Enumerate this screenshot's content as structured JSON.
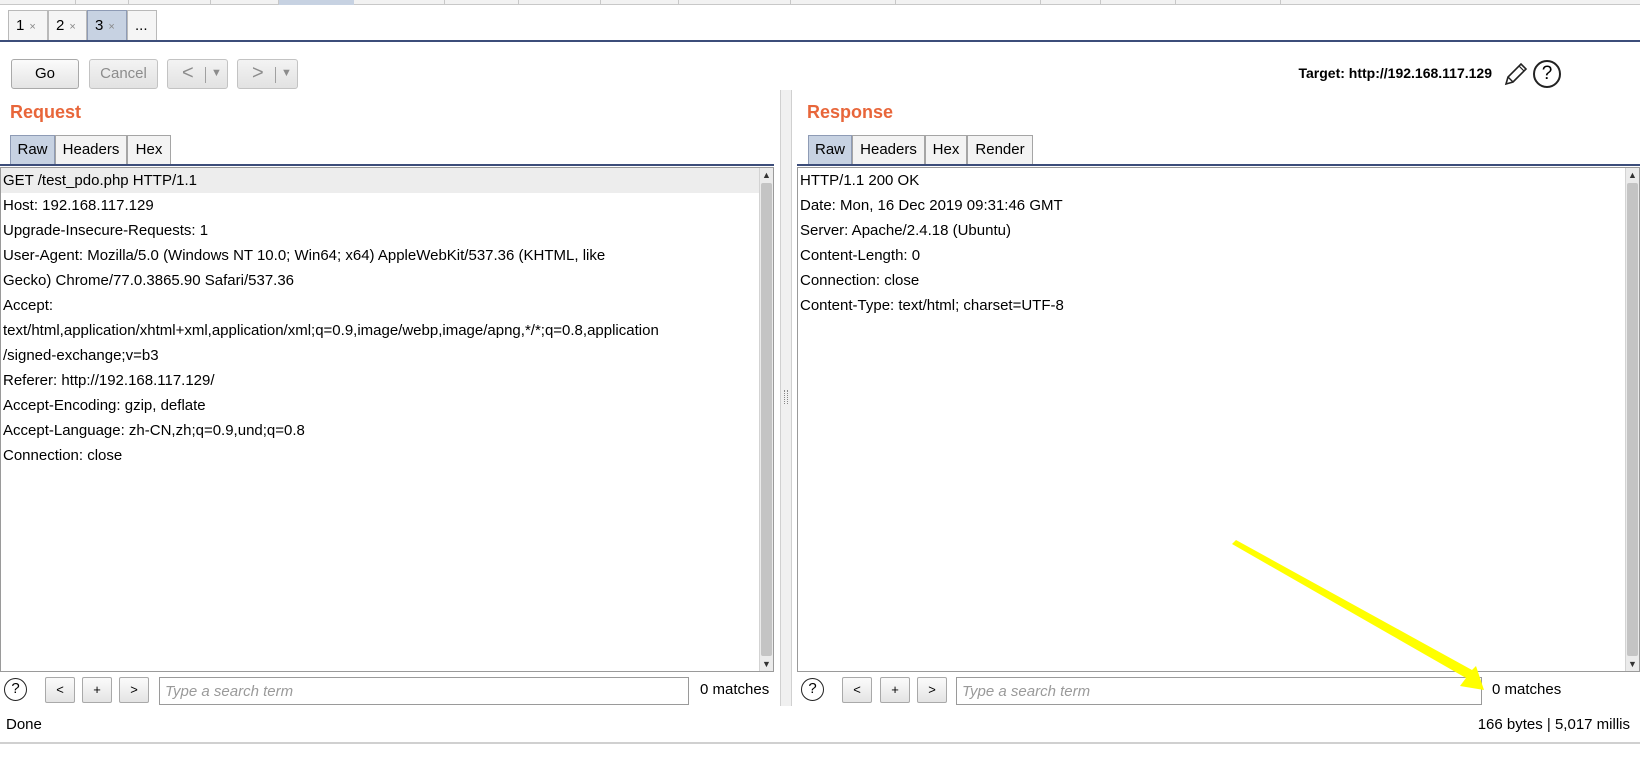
{
  "subtabs": [
    {
      "label": "1",
      "close": "×"
    },
    {
      "label": "2",
      "close": "×"
    },
    {
      "label": "3",
      "close": "×"
    },
    {
      "label": "...",
      "close": ""
    }
  ],
  "toolbar": {
    "go_label": "Go",
    "cancel_label": "Cancel",
    "back_arrow": "<",
    "forward_arrow": ">",
    "dropdown": "▼",
    "target_text": "Target: http://192.168.117.129",
    "help": "?"
  },
  "request": {
    "title": "Request",
    "tabs": [
      "Raw",
      "Headers",
      "Hex"
    ],
    "lines": [
      "GET /test_pdo.php HTTP/1.1",
      "Host: 192.168.117.129",
      "Upgrade-Insecure-Requests: 1",
      "User-Agent: Mozilla/5.0 (Windows NT 10.0; Win64; x64) AppleWebKit/537.36 (KHTML, like",
      "Gecko) Chrome/77.0.3865.90 Safari/537.36",
      "Accept:",
      "text/html,application/xhtml+xml,application/xml;q=0.9,image/webp,image/apng,*/*;q=0.8,application",
      "/signed-exchange;v=b3",
      "Referer: http://192.168.117.129/",
      "Accept-Encoding: gzip, deflate",
      "Accept-Language: zh-CN,zh;q=0.9,und;q=0.8",
      "Connection: close"
    ],
    "search": {
      "help": "?",
      "prev": "<",
      "add": "+",
      "next": ">",
      "placeholder": "Type a search term",
      "matches": "0 matches"
    }
  },
  "response": {
    "title": "Response",
    "tabs": [
      "Raw",
      "Headers",
      "Hex",
      "Render"
    ],
    "lines": [
      "HTTP/1.1 200 OK",
      "Date: Mon, 16 Dec 2019 09:31:46 GMT",
      "Server: Apache/2.4.18 (Ubuntu)",
      "Content-Length: 0",
      "Connection: close",
      "Content-Type: text/html; charset=UTF-8"
    ],
    "search": {
      "help": "?",
      "prev": "<",
      "add": "+",
      "next": ">",
      "placeholder": "Type a search term",
      "matches": "0 matches"
    }
  },
  "status": {
    "left": "Done",
    "right": "166 bytes | 5,017 millis"
  },
  "colors": {
    "pane_title": "#e8663a",
    "active_tab": "#c7d2e2",
    "annotation_arrow": "#ffff00"
  }
}
